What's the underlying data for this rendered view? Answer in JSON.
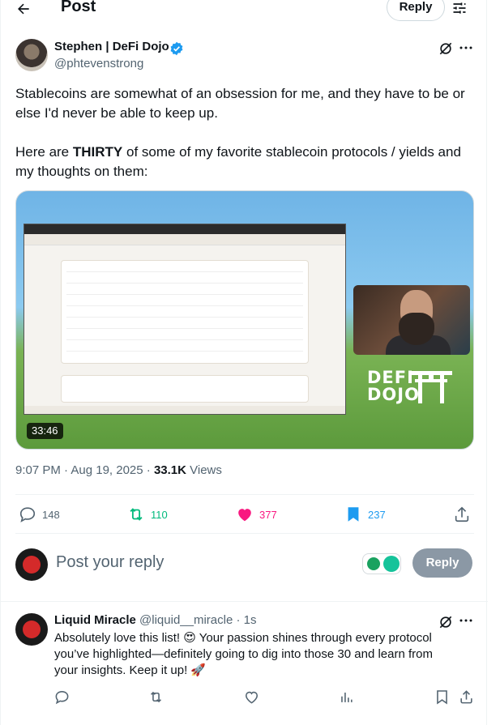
{
  "header": {
    "title": "Post",
    "reply_label": "Reply"
  },
  "author": {
    "name": "Stephen | DeFi Dojo",
    "handle": "@phtevenstrong"
  },
  "tweet": {
    "line1": "Stablecoins are somewhat of an obsession for me, and they have to be or else I'd never be able to keep up.",
    "line2_pre": "Here are ",
    "line2_bold": "THIRTY",
    "line2_post": " of some of my favorite stablecoin protocols / yields and my thoughts on them:"
  },
  "media": {
    "duration": "33:46",
    "logo_line1": "DEFI",
    "logo_line2": "DOJO"
  },
  "meta": {
    "time": "9:07 PM · Aug 19, 2025 · ",
    "views": "33.1K",
    "views_label": " Views"
  },
  "actions": {
    "replies": "148",
    "reposts": "110",
    "likes": "377",
    "bookmarks": "237"
  },
  "colors": {
    "repost": "#00ba7c",
    "like": "#f91880",
    "bookmark": "#1d9bf0",
    "verified": "#1d9bf0"
  },
  "composer": {
    "placeholder": "Post your reply",
    "button": "Reply"
  },
  "comment": {
    "name": "Liquid Miracle",
    "handle": "@liquid__miracle · 1s",
    "text": "Absolutely love this list! 😍 Your passion shines through every protocol you’ve highlighted—definitely going to dig into those 30 and learn from your insights. Keep it up! 🚀"
  },
  "icons": [
    "back-arrow-icon",
    "filter-icon",
    "verified-icon",
    "grok-icon",
    "more-icon",
    "reply-icon",
    "repost-icon",
    "heart-icon",
    "bookmark-icon",
    "share-icon",
    "views-icon"
  ]
}
